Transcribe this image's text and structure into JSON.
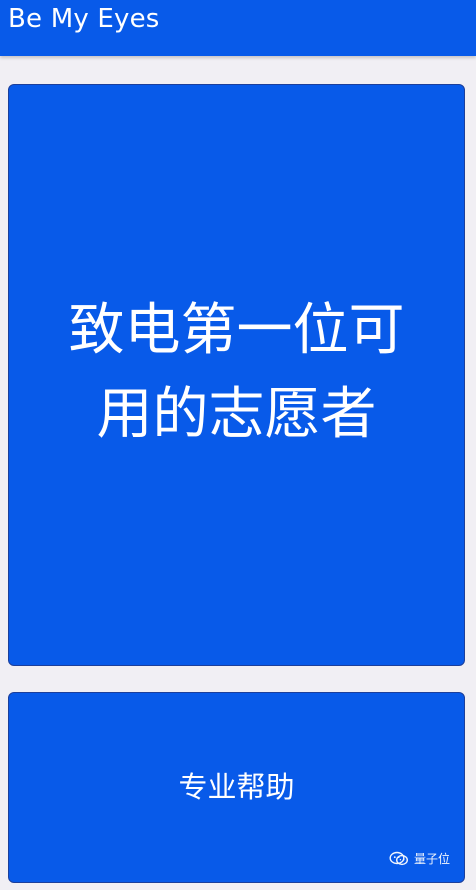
{
  "header": {
    "title": "Be My Eyes"
  },
  "cards": {
    "main": {
      "label": "致电第一位可用的志愿者"
    },
    "professional": {
      "label": "专业帮助"
    }
  },
  "watermark": {
    "text": "量子位",
    "icon": "wechat-icon"
  },
  "colors": {
    "primary_blue": "#085ae9",
    "card_border": "#1c3f9b",
    "background": "#f1eff4",
    "text": "#ffffff"
  }
}
